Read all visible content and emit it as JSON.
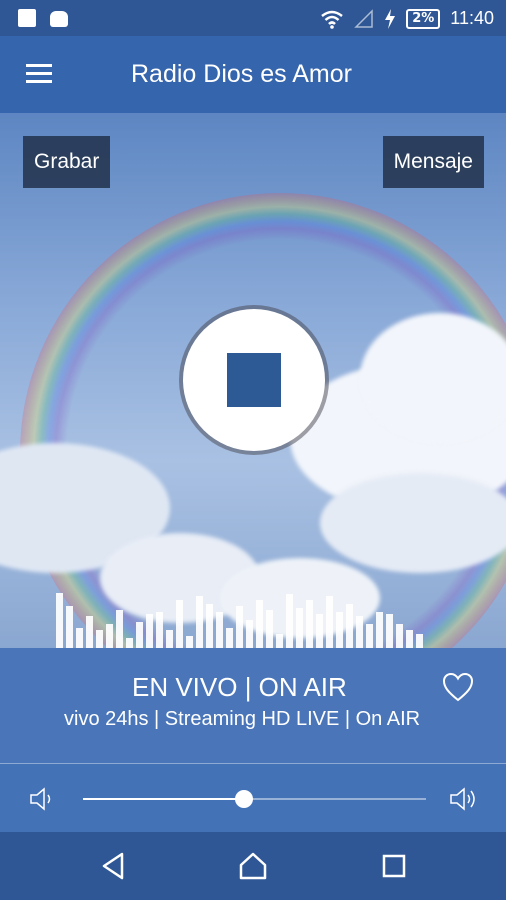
{
  "status_bar": {
    "time": "11:40",
    "battery": "2%"
  },
  "app_bar": {
    "title": "Radio Dios es Amor"
  },
  "player": {
    "record_label": "Grabar",
    "message_label": "Mensaje",
    "on_air": "EN VIVO | ON AIR",
    "ticker": "vivo 24hs | Streaming HD LIVE | On AIR",
    "volume_level": 0.47
  },
  "colors": {
    "primary": "#3565ad",
    "dark": "#2f5796",
    "info": "#4a76b9",
    "stop": "#2d5a95"
  },
  "icons": [
    "menu-icon",
    "stop-icon",
    "heart-icon",
    "volume-low-icon",
    "volume-high-icon",
    "back-icon",
    "home-icon",
    "recents-icon"
  ]
}
